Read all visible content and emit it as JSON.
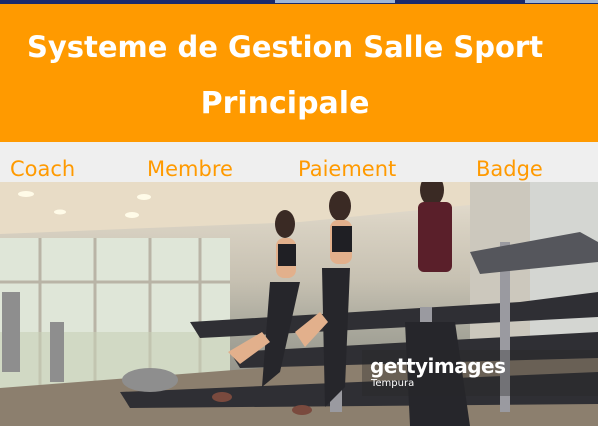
{
  "header": {
    "title_line1": "Systeme de Gestion Salle Sport",
    "title_line2": "Principale"
  },
  "menu": {
    "items": [
      {
        "label": "Coach"
      },
      {
        "label": "Membre"
      },
      {
        "label": "Paiement"
      },
      {
        "label": "Badge"
      }
    ]
  },
  "photo": {
    "watermark_brand": "gettyimages",
    "watermark_credit": "Tempura"
  },
  "colors": {
    "accent": "#ff9a00",
    "menu_bg": "#efefef",
    "header_text": "#ffffff"
  }
}
